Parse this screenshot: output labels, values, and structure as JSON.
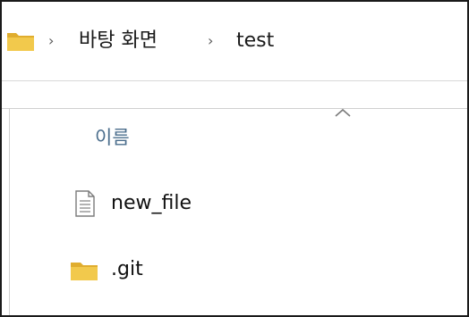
{
  "breadcrumb": {
    "items": [
      "바탕 화면",
      "test"
    ],
    "separator": "›",
    "root_icon": "folder-icon"
  },
  "file_list": {
    "column_header": "이름",
    "sort_indicator": "chevron-up-icon",
    "items": [
      {
        "name": "new_file",
        "icon": "text-file-icon"
      },
      {
        "name": ".git",
        "icon": "folder-icon"
      }
    ]
  },
  "colors": {
    "folder": "#f2c94c",
    "folder_dark": "#e0ad2e",
    "header_text": "#4a6d8c",
    "frame_border": "#1a1a1a"
  }
}
